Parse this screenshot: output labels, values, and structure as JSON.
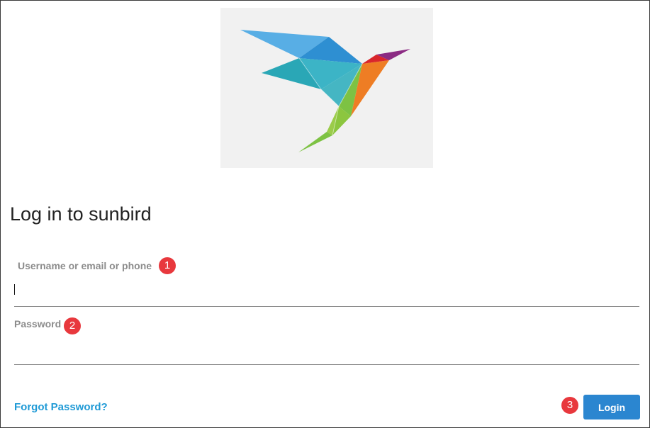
{
  "header": {
    "title": "Log in to sunbird"
  },
  "form": {
    "username_label": "Username or email or phone",
    "username_value": "",
    "password_label": "Password",
    "password_value": ""
  },
  "links": {
    "forgot_password": "Forgot Password?"
  },
  "buttons": {
    "login": "Login"
  },
  "annotations": {
    "badge_1": "1",
    "badge_2": "2",
    "badge_3": "3"
  },
  "icons": {
    "logo": "sunbird-origami-hummingbird-logo"
  },
  "colors": {
    "accent": "#2b86d0",
    "link": "#1f9ad6",
    "badge": "#e8383d",
    "logo_bg": "#f1f1f1"
  }
}
